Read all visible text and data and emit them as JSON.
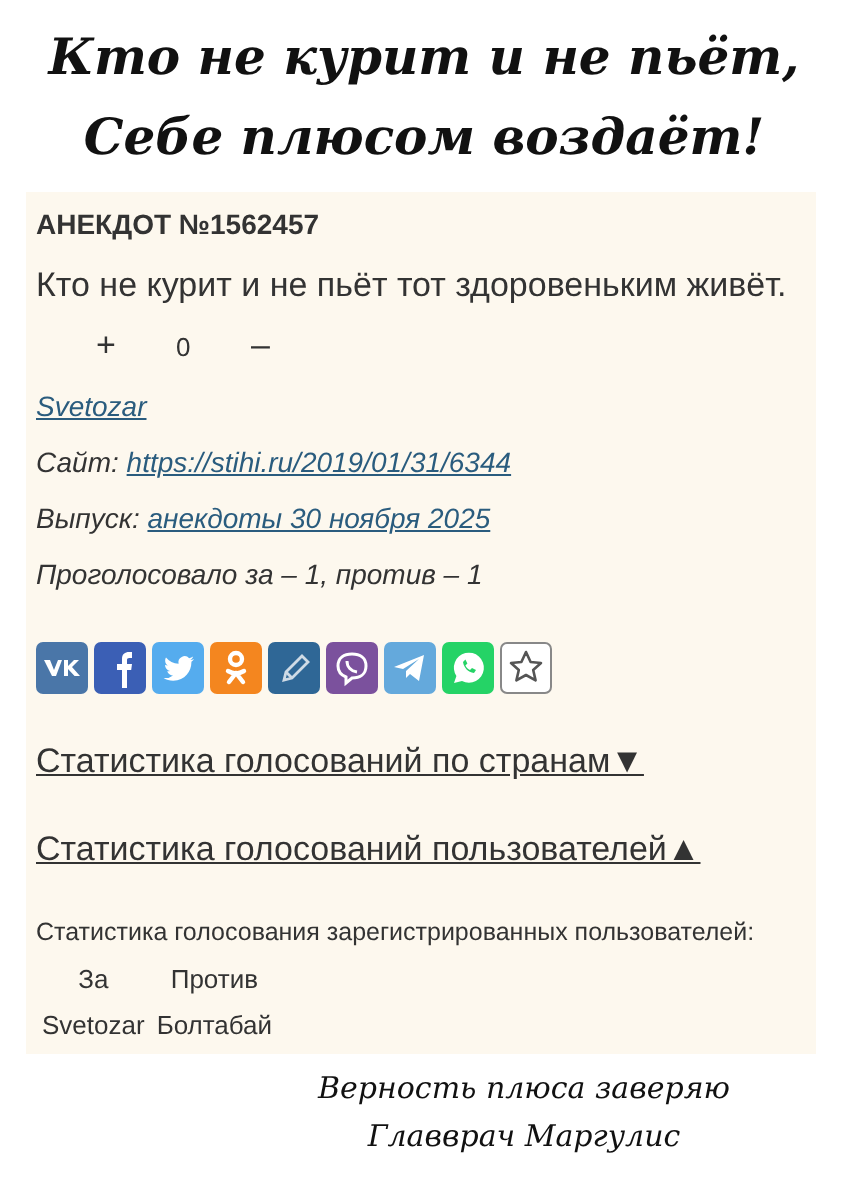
{
  "caption_top": [
    "Кто не курит и не пьёт,",
    "Себе плюсом воздаёт!"
  ],
  "joke": {
    "heading": "АНЕКДОТ №1562457",
    "text": "Кто не курит и не пьёт тот здоровеньким живёт.",
    "votes": {
      "plus": "+",
      "score": "0",
      "minus": "–"
    },
    "author": "Svetozar",
    "site": {
      "label": "Сайт:",
      "link": "https://stihi.ru/2019/01/31/6344"
    },
    "issue": {
      "label": "Выпуск:",
      "link": "анекдоты 30 ноября 2025"
    },
    "tally": "Проголосовало за – 1, против – 1"
  },
  "share_buttons": [
    {
      "kind": "vk",
      "color": "#4a76a8"
    },
    {
      "kind": "facebook",
      "color": "#3b5fb5"
    },
    {
      "kind": "twitter",
      "color": "#55acee"
    },
    {
      "kind": "ok",
      "color": "#f4861f"
    },
    {
      "kind": "pencil",
      "color": "#2f6796"
    },
    {
      "kind": "viber",
      "color": "#7b519d"
    },
    {
      "kind": "telegram",
      "color": "#64a9dc"
    },
    {
      "kind": "whatsapp",
      "color": "#25d366"
    },
    {
      "kind": "star",
      "color": "#ffffff"
    }
  ],
  "stat_links": [
    "Статистика голосований по странам▼",
    "Статистика голосований пользователей▲"
  ],
  "user_stats": {
    "title": "Статистика голосования зарегистрированных пользователей:",
    "columns": [
      "За",
      "Против"
    ],
    "rows": [
      [
        "Svetozar",
        "Болтабай"
      ]
    ]
  },
  "caption_bottom": [
    "Верность плюса заверяю",
    "Главврач Маргулис"
  ]
}
